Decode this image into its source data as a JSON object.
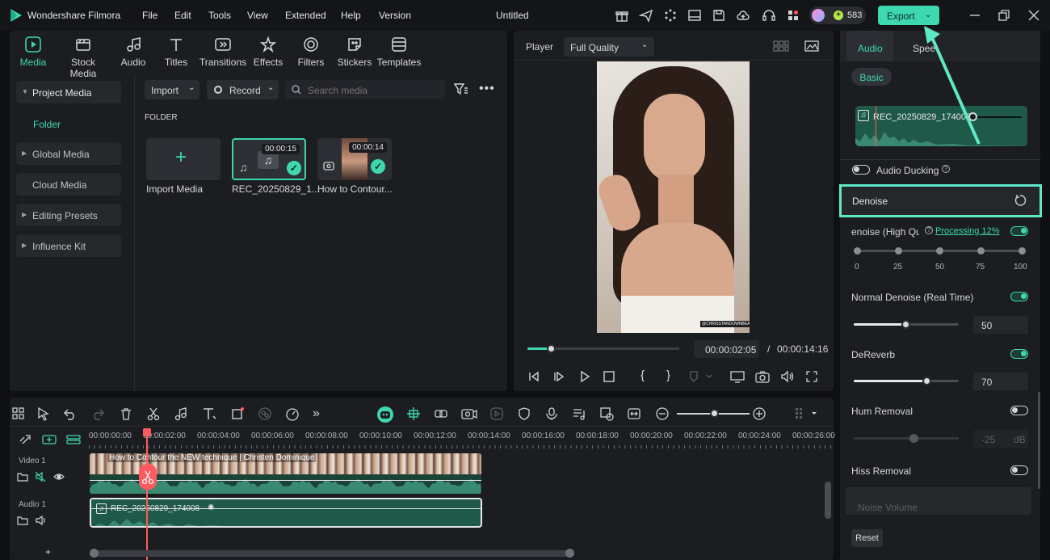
{
  "app": {
    "name": "Wondershare Filmora",
    "doc_title": "Untitled",
    "credits": "583",
    "export_label": "Export"
  },
  "menu": [
    "File",
    "Edit",
    "Tools",
    "View",
    "Extended",
    "Help",
    "Version"
  ],
  "toolbar_tabs": [
    "Media",
    "Stock Media",
    "Audio",
    "Titles",
    "Transitions",
    "Effects",
    "Filters",
    "Stickers",
    "Templates"
  ],
  "sidebar": {
    "project_media": "Project Media",
    "folder": "Folder",
    "items": [
      "Global Media",
      "Cloud Media",
      "Editing Presets",
      "Influence Kit"
    ]
  },
  "media": {
    "import_label": "Import",
    "record_label": "Record",
    "search_placeholder": "Search media",
    "folder_heading": "FOLDER",
    "items": [
      {
        "name": "Import Media"
      },
      {
        "name": "REC_20250829_1...",
        "duration": "00:00:15"
      },
      {
        "name": "How to Contour...",
        "duration": "00:00:14"
      }
    ]
  },
  "player": {
    "label": "Player",
    "quality": "Full Quality",
    "watermark": "@CHRISSTANDOWNBEAUTY",
    "current_time": "00:00:02:05",
    "separator": "/",
    "total_time": "00:00:14:16",
    "progress": 0.16
  },
  "right_panel": {
    "tabs": [
      "Audio",
      "Speed"
    ],
    "basic_label": "Basic",
    "clip_name": "REC_20250829_174008",
    "audio_ducking": "Audio Ducking",
    "denoise_header": "Denoise",
    "ai_denoise_label": "enoise (High Qua",
    "processing_text": "Processing 12%",
    "scale": [
      "0",
      "25",
      "50",
      "75",
      "100"
    ],
    "normal_denoise": {
      "label": "Normal Denoise (Real Time)",
      "value": "50",
      "level": 0.5,
      "on": true
    },
    "dereverb": {
      "label": "DeReverb",
      "value": "70",
      "level": 0.7,
      "on": true
    },
    "hum_removal": {
      "label": "Hum Removal",
      "value": "-25",
      "unit": "dB",
      "on": false
    },
    "hiss_removal": {
      "label": "Hiss Removal",
      "on": false
    },
    "noise_volume": "Noise Volume",
    "reset_label": "Reset"
  },
  "timeline": {
    "ticks": [
      "00:00:00:00",
      "00:00:02:00",
      "00:00:04:00",
      "00:00:06:00",
      "00:00:08:00",
      "00:00:10:00",
      "00:00:12:00",
      "00:00:14:00",
      "00:00:16:00",
      "00:00:18:00",
      "00:00:20:00",
      "00:00:22:00",
      "00:00:24:00",
      "00:00:26:00"
    ],
    "video_track": "Video 1",
    "audio_track": "Audio 1",
    "video_clip_title": "How to Contour the NEW technique | Christen Dominique",
    "audio_clip_title": "REC_20250829_174008"
  },
  "colors": {
    "accent": "#3dd8b0",
    "playhead": "#ff5a5f",
    "highlight_box": "#5ee8c5"
  }
}
